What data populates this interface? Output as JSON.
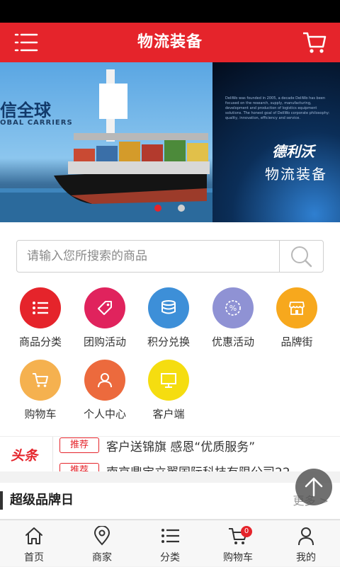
{
  "header": {
    "title": "物流装备"
  },
  "banner": {
    "slide1": {
      "headline": "信全球",
      "subtitle": "OBAL CARRIERS"
    },
    "slide2": {
      "brand": "德利沃",
      "name": "物流装备",
      "fine_print": "DeliWo was founded in 2005, a decade DeliWo has been focused on the research, supply, manufacturing, development and production of logistics equipment solutions. The honest goal of DeliWo corporate philosophy: quality, innovation, efficiency and service."
    },
    "active_slide": 1,
    "slide_count": 2
  },
  "search": {
    "placeholder": "请输入您所搜索的商品"
  },
  "categories": [
    {
      "label": "商品分类",
      "icon": "list-icon",
      "color": "#e5242b"
    },
    {
      "label": "团购活动",
      "icon": "tag-icon",
      "color": "#e0235d"
    },
    {
      "label": "积分兑换",
      "icon": "coins-icon",
      "color": "#3d8fd8"
    },
    {
      "label": "优惠活动",
      "icon": "discount-icon",
      "color": "#8f92d4"
    },
    {
      "label": "品牌街",
      "icon": "shop-icon",
      "color": "#f7a81d"
    },
    {
      "label": "购物车",
      "icon": "cart-icon",
      "color": "#f5b14f"
    },
    {
      "label": "个人中心",
      "icon": "user-icon",
      "color": "#ec6a3d"
    },
    {
      "label": "客户端",
      "icon": "monitor-icon",
      "color": "#f5dd10"
    }
  ],
  "news": {
    "tag": "头条",
    "items": [
      {
        "pill": "推荐",
        "text": "客户送锦旗 感恩“优质服务”"
      },
      {
        "pill": "推荐",
        "text": "南京鼎宝立翼国际科技有限公司22"
      }
    ]
  },
  "section": {
    "title": "超级品牌日",
    "more": "更多 >"
  },
  "tabbar": [
    {
      "label": "首页",
      "icon": "home-icon"
    },
    {
      "label": "商家",
      "icon": "location-pin-icon"
    },
    {
      "label": "分类",
      "icon": "list-icon"
    },
    {
      "label": "购物车",
      "icon": "cart-icon",
      "badge": "0"
    },
    {
      "label": "我的",
      "icon": "user-icon"
    }
  ]
}
